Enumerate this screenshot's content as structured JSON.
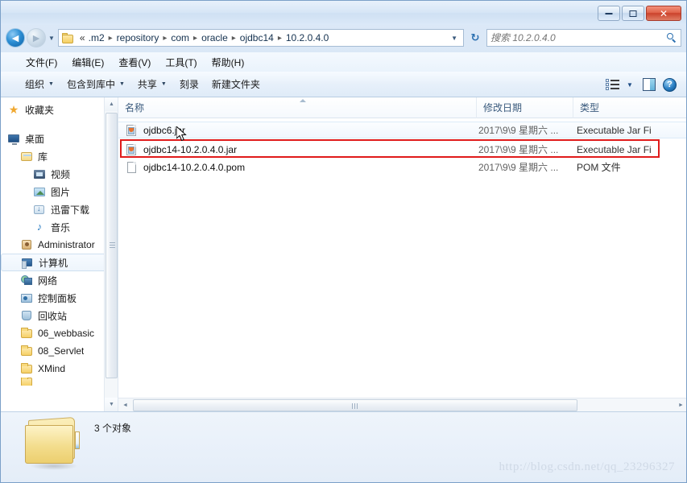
{
  "window": {
    "controls": {
      "minimize_label": "最小化",
      "maximize_label": "最大化",
      "close_label": "✕"
    }
  },
  "address_bar": {
    "back_label": "◄",
    "forward_label": "►",
    "history_label": "▼",
    "folder_prefix": "«",
    "breadcrumbs": [
      {
        "label": ".m2"
      },
      {
        "label": "repository"
      },
      {
        "label": "com"
      },
      {
        "label": "oracle"
      },
      {
        "label": "ojdbc14"
      },
      {
        "label": "10.2.0.4.0"
      }
    ],
    "separator": "▸",
    "dropdown_label": "▼",
    "refresh_label": "↻"
  },
  "search": {
    "placeholder": "搜索 10.2.0.4.0",
    "value": ""
  },
  "menubar": {
    "items": [
      {
        "label": "文件(F)"
      },
      {
        "label": "编辑(E)"
      },
      {
        "label": "查看(V)"
      },
      {
        "label": "工具(T)"
      },
      {
        "label": "帮助(H)"
      }
    ]
  },
  "toolbar": {
    "buttons": [
      {
        "label": "组织",
        "caret": "▼"
      },
      {
        "label": "包含到库中",
        "caret": "▼"
      },
      {
        "label": "共享",
        "caret": "▼"
      },
      {
        "label": "刻录",
        "caret": ""
      },
      {
        "label": "新建文件夹",
        "caret": ""
      }
    ],
    "view_caret": "▼",
    "help_label": "?"
  },
  "sidebar": {
    "items": [
      {
        "label": "收藏夹",
        "icon": "star-icon",
        "indent": 0,
        "selected": false
      },
      {
        "label": "桌面",
        "icon": "desktop-icon",
        "indent": 0,
        "selected": false
      },
      {
        "label": "库",
        "icon": "library-icon",
        "indent": 1,
        "selected": false
      },
      {
        "label": "视频",
        "icon": "video-icon",
        "indent": 2,
        "selected": false
      },
      {
        "label": "图片",
        "icon": "picture-icon",
        "indent": 2,
        "selected": false
      },
      {
        "label": "迅雷下载",
        "icon": "download-icon",
        "indent": 2,
        "selected": false
      },
      {
        "label": "音乐",
        "icon": "music-icon",
        "indent": 2,
        "selected": false
      },
      {
        "label": "Administrator",
        "icon": "user-icon",
        "indent": 1,
        "selected": false
      },
      {
        "label": "计算机",
        "icon": "computer-icon",
        "indent": 1,
        "selected": true
      },
      {
        "label": "网络",
        "icon": "network-icon",
        "indent": 1,
        "selected": false
      },
      {
        "label": "控制面板",
        "icon": "control-panel-icon",
        "indent": 1,
        "selected": false
      },
      {
        "label": "回收站",
        "icon": "recycle-bin-icon",
        "indent": 1,
        "selected": false
      },
      {
        "label": "06_webbasic",
        "icon": "folder-icon",
        "indent": 1,
        "selected": false
      },
      {
        "label": "08_Servlet",
        "icon": "folder-icon",
        "indent": 1,
        "selected": false
      },
      {
        "label": "XMind",
        "icon": "folder-icon",
        "indent": 1,
        "selected": false
      }
    ],
    "scroll_up": "▲",
    "scroll_down": "▼"
  },
  "file_list": {
    "columns": [
      {
        "label": "名称"
      },
      {
        "label": "修改日期"
      },
      {
        "label": "类型"
      }
    ],
    "rows": [
      {
        "name": "ojdbc6.jar",
        "date": "2017\\9\\9 星期六 ...",
        "type": "Executable Jar Fi",
        "icon": "jar-file-icon",
        "hover": true,
        "annotated": false
      },
      {
        "name": "ojdbc14-10.2.0.4.0.jar",
        "date": "2017\\9\\9 星期六 ...",
        "type": "Executable Jar Fi",
        "icon": "jar-file-icon",
        "hover": false,
        "annotated": true
      },
      {
        "name": "ojdbc14-10.2.0.4.0.pom",
        "date": "2017\\9\\9 星期六 ...",
        "type": "POM 文件",
        "icon": "document-file-icon",
        "hover": false,
        "annotated": false
      }
    ],
    "hscroll_left": "◄",
    "hscroll_right": "►"
  },
  "status": {
    "text": "3 个对象"
  },
  "watermark": {
    "text": "http://blog.csdn.net/qq_23296327"
  },
  "colors": {
    "accent": "#2a6fb0",
    "annotation": "#e01b1b",
    "close_button": "#cb422c",
    "folder": "#f3dd8d"
  }
}
